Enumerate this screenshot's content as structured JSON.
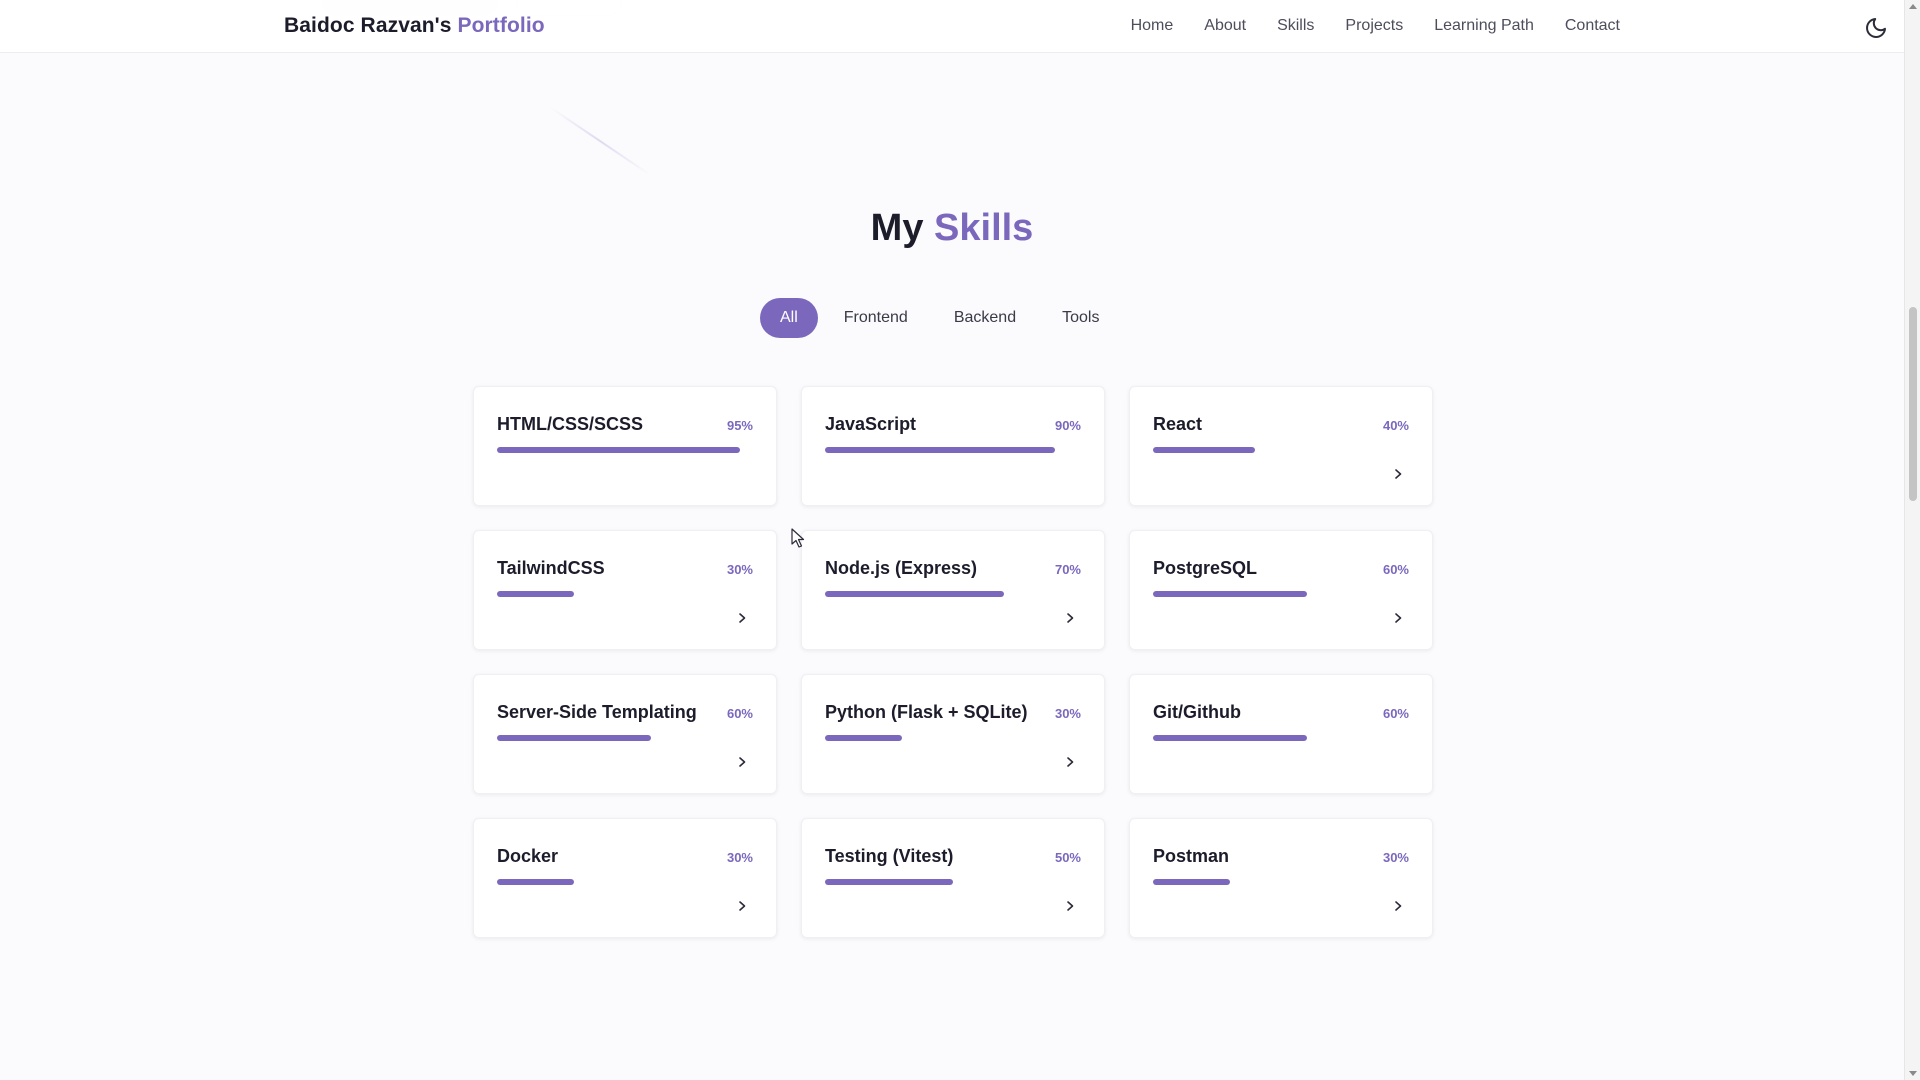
{
  "header": {
    "brand_name": "Baidoc Razvan's",
    "brand_accent": "Portfolio",
    "nav": [
      "Home",
      "About",
      "Skills",
      "Projects",
      "Learning Path",
      "Contact"
    ],
    "theme_toggle_icon": "moon-icon"
  },
  "section": {
    "title_main": "My",
    "title_accent": "Skills"
  },
  "filters": {
    "items": [
      "All",
      "Frontend",
      "Backend",
      "Tools"
    ],
    "active": "All"
  },
  "skills": [
    {
      "name": "HTML/CSS/SCSS",
      "percent_label": "95%",
      "level": 95,
      "expandable": false
    },
    {
      "name": "JavaScript",
      "percent_label": "90%",
      "level": 90,
      "expandable": false
    },
    {
      "name": "React",
      "percent_label": "40%",
      "level": 40,
      "expandable": true
    },
    {
      "name": "TailwindCSS",
      "percent_label": "30%",
      "level": 30,
      "expandable": true
    },
    {
      "name": "Node.js (Express)",
      "percent_label": "70%",
      "level": 70,
      "expandable": true
    },
    {
      "name": "PostgreSQL",
      "percent_label": "60%",
      "level": 60,
      "expandable": true
    },
    {
      "name": "Server-Side Templating",
      "percent_label": "60%",
      "level": 60,
      "expandable": true
    },
    {
      "name": "Python (Flask + SQLite)",
      "percent_label": "30%",
      "level": 30,
      "expandable": true
    },
    {
      "name": "Git/Github",
      "percent_label": "60%",
      "level": 60,
      "expandable": false
    },
    {
      "name": "Docker",
      "percent_label": "30%",
      "level": 30,
      "expandable": true
    },
    {
      "name": "Testing (Vitest)",
      "percent_label": "50%",
      "level": 50,
      "expandable": true
    },
    {
      "name": "Postman",
      "percent_label": "30%",
      "level": 30,
      "expandable": true
    }
  ],
  "colors": {
    "accent": "#7b68bd",
    "text": "#1c1c2b",
    "background": "#fbfbfd"
  }
}
